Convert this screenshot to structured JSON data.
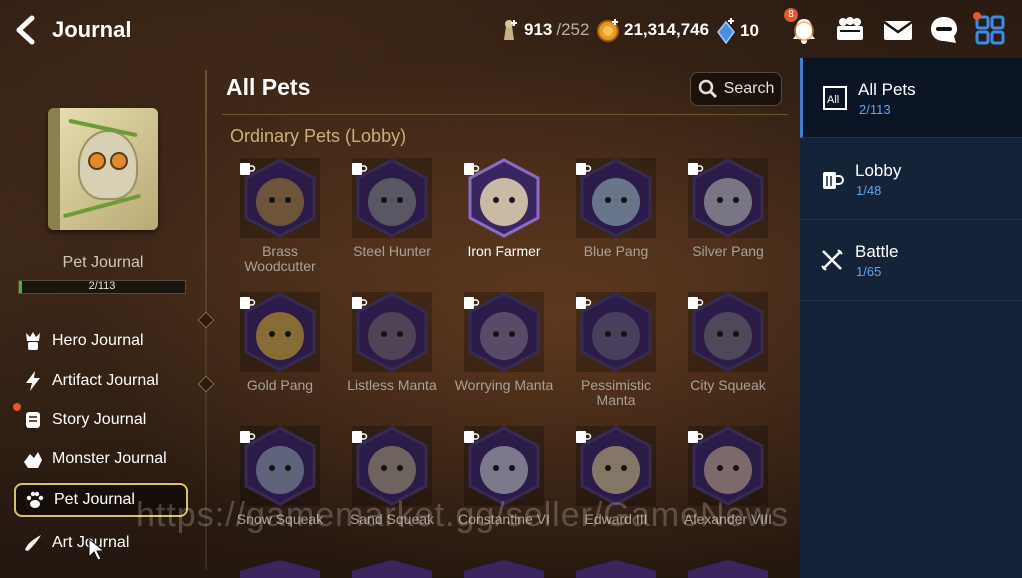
{
  "header": {
    "title": "Journal",
    "stamina": {
      "value": "913",
      "max": "/252"
    },
    "gold": "21,314,746",
    "crystals": "10",
    "notification_count": "8"
  },
  "left": {
    "journal_name": "Pet Journal",
    "progress_text": "2/113",
    "progress_fraction": 0.018,
    "nav": [
      {
        "label": "Hero Journal",
        "icon": "hero-icon"
      },
      {
        "label": "Artifact Journal",
        "icon": "lightning-icon"
      },
      {
        "label": "Story Journal",
        "icon": "scroll-icon"
      },
      {
        "label": "Monster Journal",
        "icon": "monster-icon"
      },
      {
        "label": "Pet Journal",
        "icon": "paw-icon",
        "active": true
      },
      {
        "label": "Art Journal",
        "icon": "brush-icon"
      }
    ]
  },
  "main": {
    "title": "All Pets",
    "search_label": "Search",
    "section_title": "Ordinary Pets (Lobby)",
    "pets": [
      {
        "name": "Brass\nWoodcutter",
        "color": "#b08a4a"
      },
      {
        "name": "Steel Hunter",
        "color": "#8d8f93"
      },
      {
        "name": "Iron Farmer",
        "color": "#c9b9a5",
        "unlocked": true
      },
      {
        "name": "Blue Pang",
        "color": "#a9c4d8"
      },
      {
        "name": "Silver Pang",
        "color": "#c6c6cc"
      },
      {
        "name": "Gold Pang",
        "color": "#e0b640"
      },
      {
        "name": "Listless Manta",
        "color": "#7b6c78"
      },
      {
        "name": "Worrying Manta",
        "color": "#8b7a98"
      },
      {
        "name": "Pessimistic\nManta",
        "color": "#6d6686"
      },
      {
        "name": "City Squeak",
        "color": "#7a7480"
      },
      {
        "name": "Snow Squeak",
        "color": "#9aa4be"
      },
      {
        "name": "Sand Squeak",
        "color": "#b4a48a"
      },
      {
        "name": "Constantine VI",
        "color": "#c8ccd8"
      },
      {
        "name": "Edward III",
        "color": "#d8c89a"
      },
      {
        "name": "Alexander VIII",
        "color": "#c8b0a0"
      }
    ]
  },
  "right": {
    "tabs": [
      {
        "label": "All Pets",
        "count": "2/113",
        "active": true
      },
      {
        "label": "Lobby",
        "count": "1/48"
      },
      {
        "label": "Battle",
        "count": "1/65"
      }
    ]
  },
  "watermark": "https://gamemarket.gg/seller/GameNews"
}
